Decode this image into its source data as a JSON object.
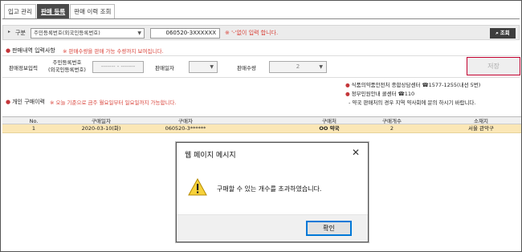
{
  "tabs": [
    {
      "label": "입고 관리",
      "active": false
    },
    {
      "label": "판매 등록",
      "active": true
    },
    {
      "label": "판매 이력 조회",
      "active": false
    }
  ],
  "search": {
    "category_label": "구분",
    "id_type_value": "주민등록번호(외국인등록번호)",
    "id_value": "060520-3XXXXXX",
    "hint": "'-'없이 입력 합니다.",
    "query_button": "조회"
  },
  "sales_entry": {
    "title": "판매내역 입력사항",
    "note": "판매수량을 판매 가능 수량까지 보여집니다.",
    "section_label": "판매정보입력",
    "id_label_line1": "주민등록번호",
    "id_label_line2": "(외국인등록번호)",
    "id_field_value": "------- - -------",
    "date_label": "판매일자",
    "quantity_label": "판매수량",
    "quantity_value": "2",
    "save_button": "저장"
  },
  "contact_info": {
    "line1": "식품의약품안전처 종합상담센터 ☎1577-1255(내선 5번)",
    "line2": "정부민원안내 콜센터 ☎110",
    "line3": "- 약국 판매처의 경우 지역 약사회에 문의 하시기 바랍니다."
  },
  "purchase_history": {
    "title": "개인 구매이력",
    "note": "오늘 기준으로 금주 월요일부터 일요일까지 가능합니다.",
    "columns": [
      "No.",
      "구매일자",
      "구매자",
      "구매처",
      "구매개수",
      "소재지"
    ],
    "rows": [
      {
        "no": "1",
        "date": "2020-03-10(화)",
        "buyer": "060520-3******",
        "store": "OO 약국",
        "count": "2",
        "location": "서울 관악구"
      }
    ]
  },
  "dialog": {
    "title": "웹 페이지 메시지",
    "message": "구매할 수 있는 개수를 초과하였습니다.",
    "ok_button": "확인",
    "icon": "warning-icon"
  },
  "colors": {
    "accent_red": "#c4363a",
    "row_highlight": "#fbe7b6",
    "dialog_button_border": "#0078d7"
  }
}
